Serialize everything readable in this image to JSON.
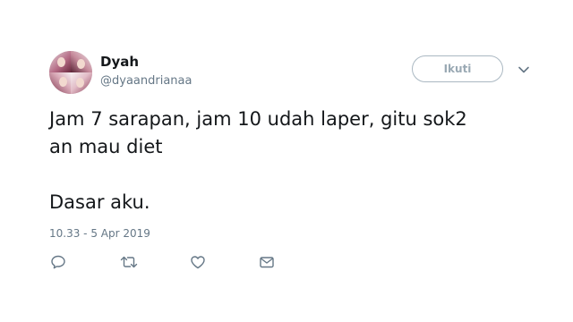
{
  "tweet": {
    "author": {
      "name": "Dyah",
      "handle": "@dyaandrianaa"
    },
    "follow_button_label": "Ikuti",
    "lines": [
      "Jam 7 sarapan, jam 10 udah laper, gitu sok2",
      "an mau diet",
      "",
      "Dasar aku."
    ],
    "timestamp": "10.33 - 5 Apr 2019",
    "actions": {
      "reply_icon": "reply-icon",
      "retweet_icon": "retweet-icon",
      "like_icon": "heart-icon",
      "message_icon": "envelope-icon"
    },
    "colors": {
      "text": "#14171a",
      "secondary": "#657786",
      "button_border": "#aab8c2"
    }
  }
}
